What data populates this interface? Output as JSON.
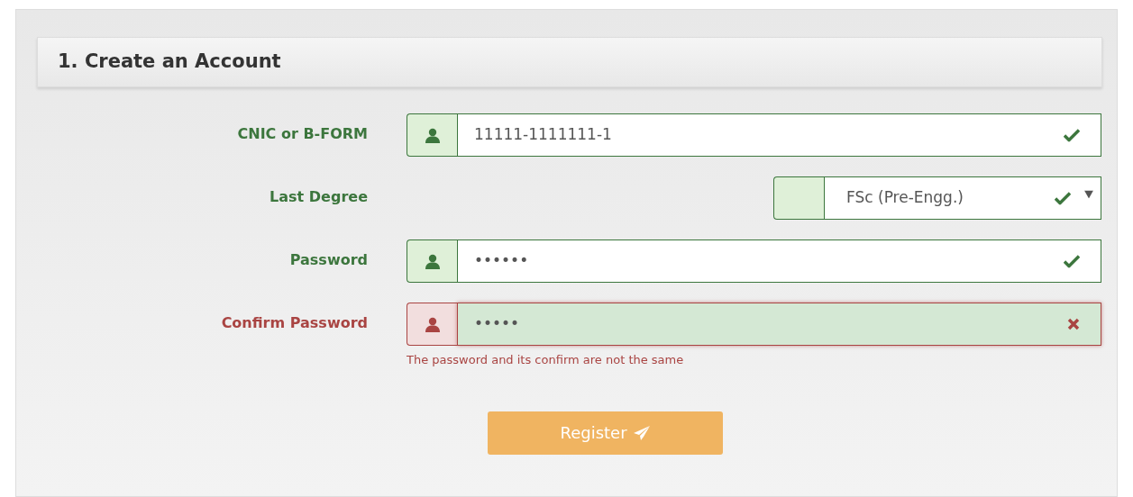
{
  "section": {
    "title": "1. Create an Account"
  },
  "fields": [
    {
      "label": "CNIC or B-FORM",
      "kind": "text",
      "value": "11111-1111111-1",
      "valid": true,
      "icon": true
    },
    {
      "label": "Last Degree",
      "kind": "select",
      "value": "FSc (Pre-Engg.)",
      "valid": true,
      "icon": false
    },
    {
      "label": "Password",
      "kind": "text",
      "value": "••••••",
      "valid": true,
      "icon": true
    },
    {
      "label": "Confirm Password",
      "kind": "text",
      "value": "•••••",
      "valid": false,
      "icon": true,
      "error": "The password and its confirm are not the same"
    }
  ],
  "button": {
    "label": "Register"
  }
}
